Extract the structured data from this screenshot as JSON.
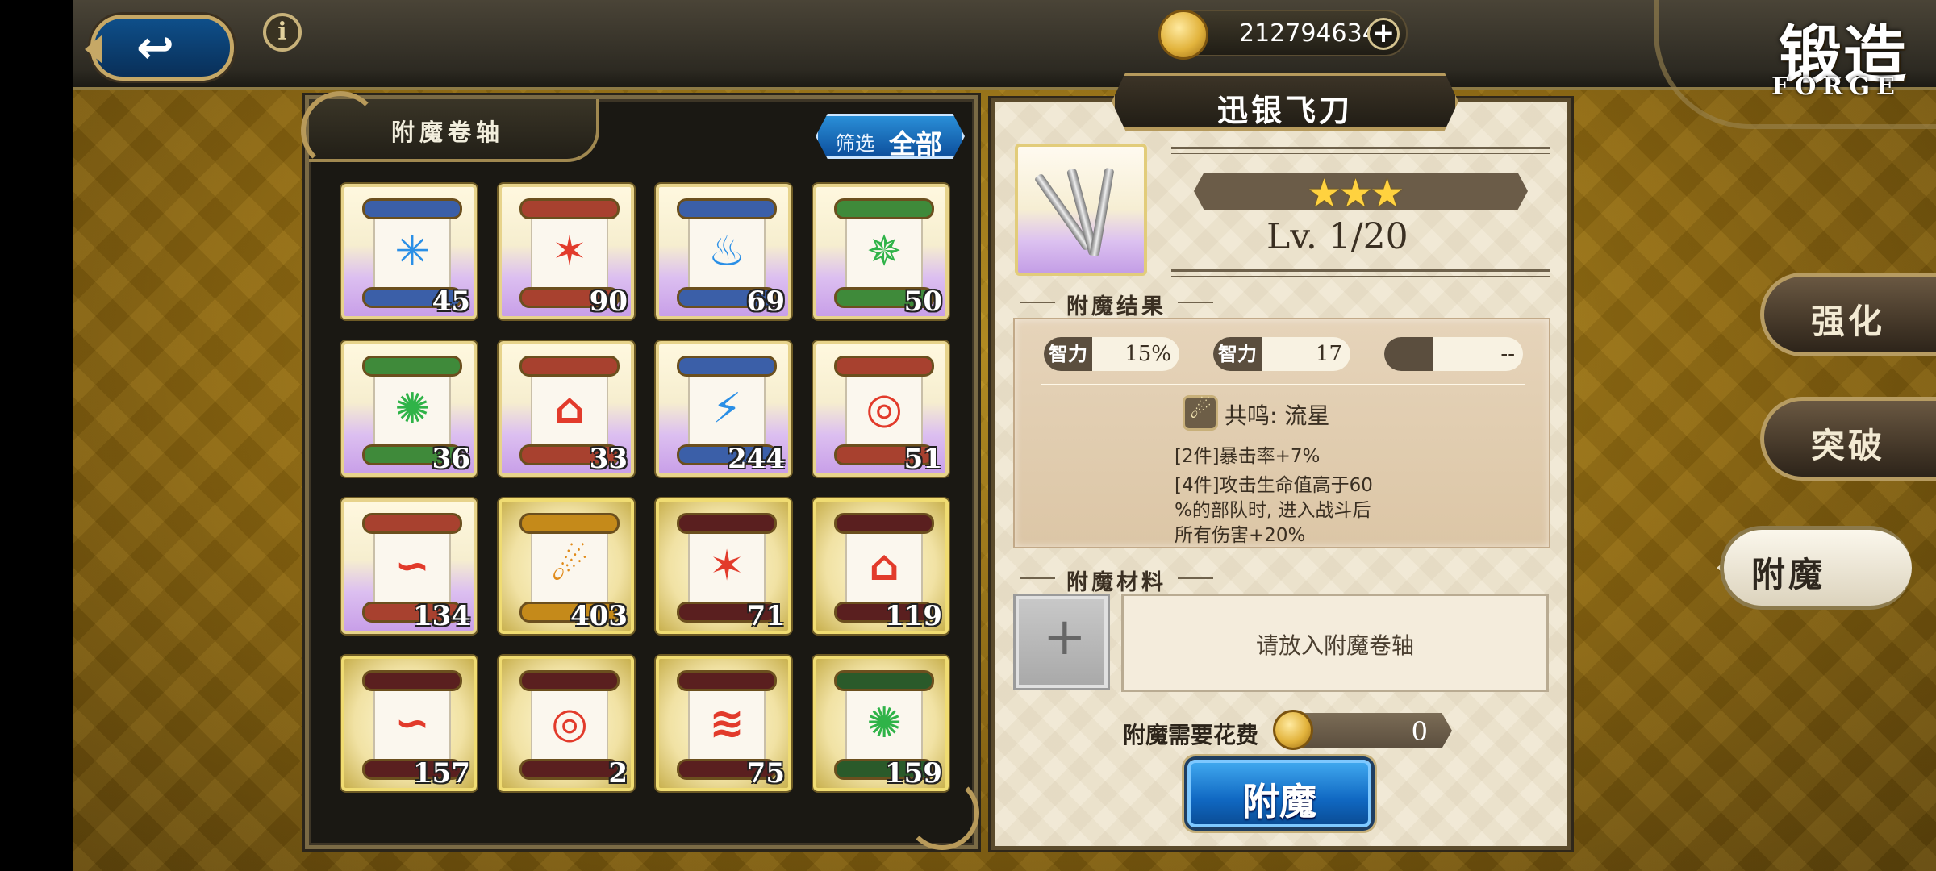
{
  "topbar": {
    "back_label": "↩",
    "info_label": "i",
    "gold_amount": "212794634",
    "gold_plus": "+",
    "title_cn": "锻造",
    "title_en": "FORGE"
  },
  "left_panel": {
    "title": "附魔卷轴",
    "filter_label": "筛选",
    "filter_value": "全部",
    "items": [
      {
        "qty": "45",
        "frame": "rainbow",
        "rod": "#3b5fa8",
        "rune": "✳",
        "rune_color": "#2a8fe6"
      },
      {
        "qty": "90",
        "frame": "rainbow",
        "rod": "#a8412f",
        "rune": "✶",
        "rune_color": "#e23b2b"
      },
      {
        "qty": "69",
        "frame": "rainbow",
        "rod": "#3b5fa8",
        "rune": "♨",
        "rune_color": "#2a8fe6"
      },
      {
        "qty": "50",
        "frame": "rainbow",
        "rod": "#3f8a3a",
        "rune": "✵",
        "rune_color": "#2fb348"
      },
      {
        "qty": "36",
        "frame": "rainbow",
        "rod": "#3f8a3a",
        "rune": "✺",
        "rune_color": "#2fb348"
      },
      {
        "qty": "33",
        "frame": "rainbow",
        "rod": "#a8412f",
        "rune": "⌂",
        "rune_color": "#e23b2b"
      },
      {
        "qty": "244",
        "frame": "rainbow",
        "rod": "#3b5fa8",
        "rune": "⚡",
        "rune_color": "#2a8fe6"
      },
      {
        "qty": "51",
        "frame": "rainbow",
        "rod": "#a8412f",
        "rune": "◎",
        "rune_color": "#e23b2b"
      },
      {
        "qty": "134",
        "frame": "rainbow",
        "rod": "#a8412f",
        "rune": "∽",
        "rune_color": "#e23b2b"
      },
      {
        "qty": "403",
        "frame": "gold",
        "rod": "#c58a1a",
        "rune": "☄",
        "rune_color": "#e08a18"
      },
      {
        "qty": "71",
        "frame": "gold",
        "rod": "#5a1f1f",
        "rune": "✶",
        "rune_color": "#e23b2b"
      },
      {
        "qty": "119",
        "frame": "gold",
        "rod": "#5a1f1f",
        "rune": "⌂",
        "rune_color": "#e23b2b"
      },
      {
        "qty": "157",
        "frame": "gold",
        "rod": "#5a1f1f",
        "rune": "∽",
        "rune_color": "#e23b2b"
      },
      {
        "qty": "2",
        "frame": "gold",
        "rod": "#5a1f1f",
        "rune": "◎",
        "rune_color": "#e23b2b"
      },
      {
        "qty": "75",
        "frame": "gold",
        "rod": "#5a1f1f",
        "rune": "≋",
        "rune_color": "#e23b2b"
      },
      {
        "qty": "159",
        "frame": "gold",
        "rod": "#2a5a2a",
        "rune": "✺",
        "rune_color": "#2fb348"
      }
    ]
  },
  "weapon": {
    "name": "迅银飞刀",
    "stars": "★★★",
    "level": "Lv. 1/20"
  },
  "result": {
    "section_title": "附魔结果",
    "stat1_label": "智力",
    "stat1_value": "15%",
    "stat2_label": "智力",
    "stat2_value": "17",
    "stat3_value": "--",
    "resonance": "共鸣: 流星",
    "effect1": "[2件]暴击率+7%",
    "effect2_line1": "[4件]攻击生命值高于60",
    "effect2_line2": "%的部队时, 进入战斗后",
    "effect2_line3": "所有伤害+20%"
  },
  "materials": {
    "section_title": "附魔材料",
    "add_symbol": "+",
    "placeholder": "请放入附魔卷轴",
    "cost_label": "附魔需要花费",
    "cost_value": "0",
    "enchant_button": "附魔"
  },
  "side_tabs": {
    "strengthen": "强化",
    "breakthrough": "突破",
    "enchant": "附魔"
  },
  "colors": {
    "accent_blue": "#1068c2",
    "gold": "#e2b33c",
    "panel_dark": "#1a1813",
    "parchment": "#f1e9d6"
  }
}
